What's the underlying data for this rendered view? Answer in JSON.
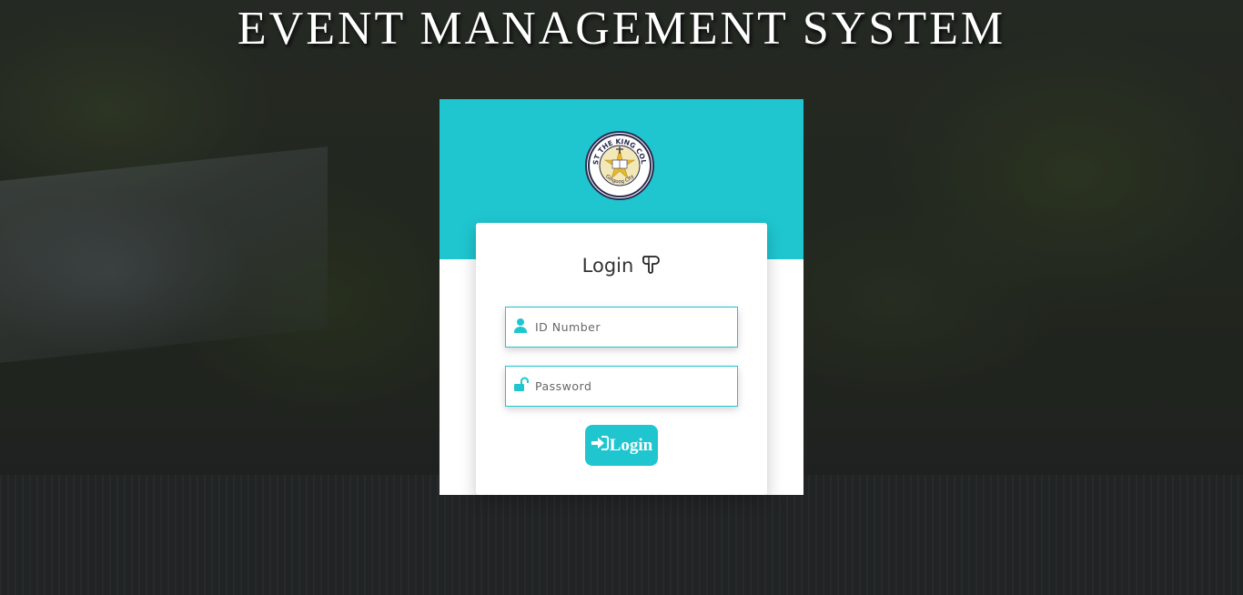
{
  "header": {
    "title": "EVENT MANAGEMENT SYSTEM"
  },
  "logo": {
    "text_top": "CHRIST THE KING COLLEGE",
    "text_bottom": "Gingoog City"
  },
  "login_card": {
    "title": "Login",
    "pointer_icon": "hand-pointing-down-icon",
    "id_field": {
      "icon": "user-icon",
      "placeholder": "ID Number",
      "value": ""
    },
    "password_field": {
      "icon": "unlock-icon",
      "placeholder": "Password",
      "value": ""
    },
    "submit": {
      "icon": "sign-in-icon",
      "label": "Login"
    }
  },
  "colors": {
    "accent": "#1fc6d0",
    "title_text": "#ffffff",
    "card_bg": "#ffffff"
  }
}
